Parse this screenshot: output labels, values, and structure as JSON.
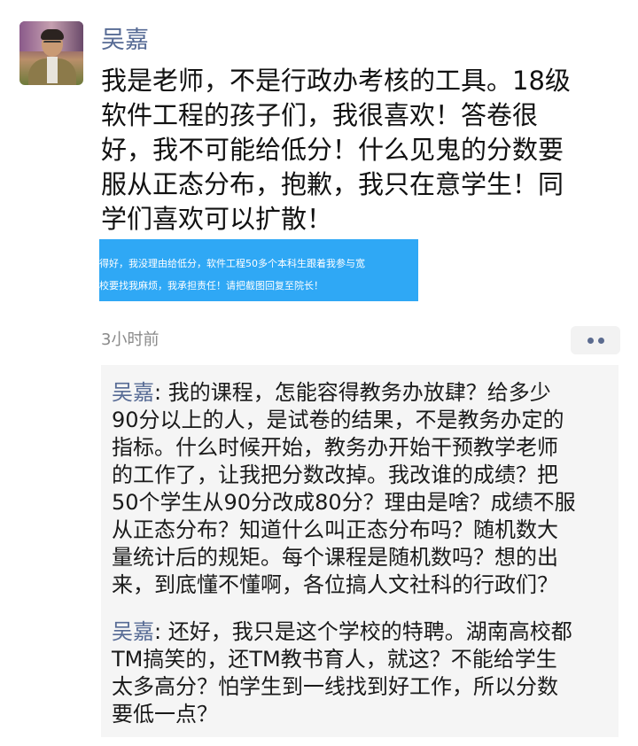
{
  "post": {
    "author": "吴嘉",
    "text": "我是老师，不是行政办考核的工具。18级\n软件工程的孩子们，我很喜欢！答卷很\n好，我不可能给低分！什么见鬼的分数要\n服从正态分布，抱歉，我只在意学生！同\n学们喜欢可以扩散！",
    "image_text": {
      "line1": "得好，我没理由给低分，软件工程50多个本科生跟着我参与宽",
      "line2": "校要找我麻烦，我承担责任！请把截图回复至院长！"
    },
    "timestamp": "3小时前"
  },
  "comments": [
    {
      "author": "吴嘉",
      "separator": ": ",
      "text": "我的课程，怎能容得教务办放肆？给多少\n90分以上的人，是试卷的结果，不是教务办定的\n指标。什么时候开始，教务办开始干预教学老师\n的工作了，让我把分数改掉。我改谁的成绩？把\n50个学生从90分改成80分？理由是啥？成绩不服\n从正态分布？知道什么叫正态分布吗？随机数大\n量统计后的规矩。每个课程是随机数吗？想的出\n来，到底懂不懂啊，各位搞人文社科的行政们？"
    },
    {
      "author": "吴嘉",
      "separator": ": ",
      "text": "还好，我只是这个学校的特聘。湖南高校都\nTM搞笑的，还TM教书育人，就这？不能给学生\n太多高分？怕学生到一线找到好工作，所以分数\n要低一点？"
    }
  ],
  "colors": {
    "name_link": "#576b95",
    "image_bg": "#2fa8f5",
    "comment_bg": "#f5f5f5"
  },
  "icons": {
    "more": "more-dots-icon"
  }
}
